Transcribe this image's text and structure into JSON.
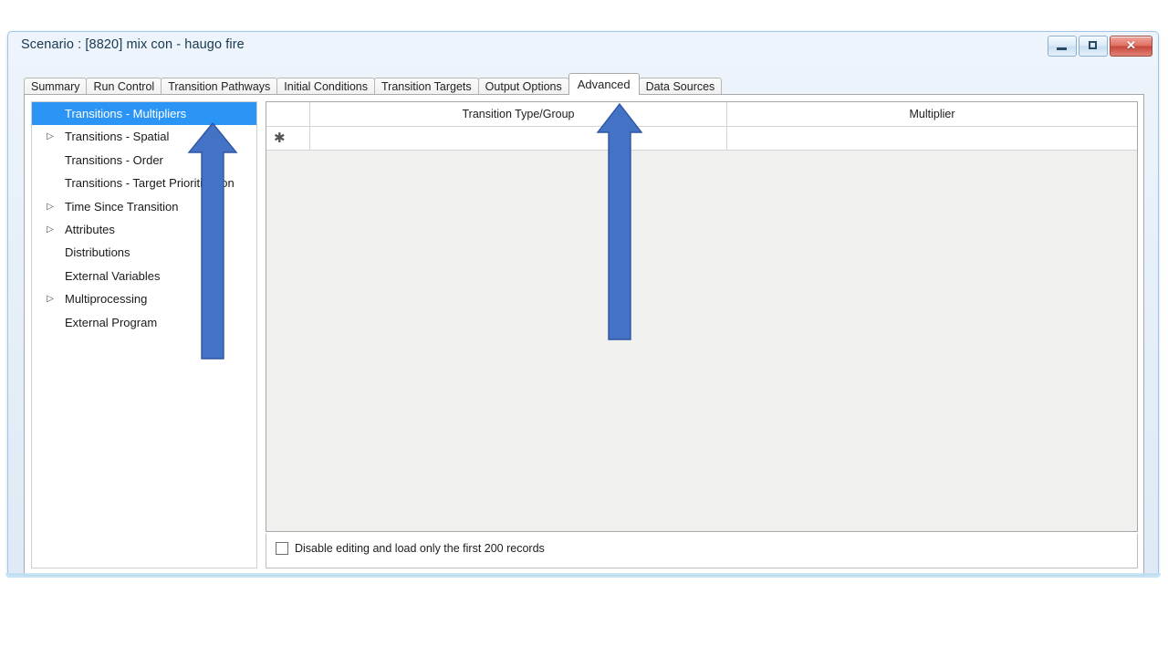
{
  "window": {
    "title": "Scenario : [8820] mix con - haugo fire",
    "controls": [
      {
        "name": "minimize-button",
        "glyph": "minimize-icon"
      },
      {
        "name": "maximize-button",
        "glyph": "maximize-icon"
      },
      {
        "name": "close-button",
        "glyph": "close-icon",
        "label": "✕"
      }
    ],
    "accent_color": "#9fc6e8"
  },
  "tabs": {
    "selected": "Advanced",
    "items": [
      {
        "label": "Summary"
      },
      {
        "label": "Run Control"
      },
      {
        "label": "Transition Pathways"
      },
      {
        "label": "Initial Conditions"
      },
      {
        "label": "Transition Targets"
      },
      {
        "label": "Output Options"
      },
      {
        "label": "Advanced"
      },
      {
        "label": "Data Sources"
      }
    ]
  },
  "tree": {
    "selected": "Transitions - Multipliers",
    "selection_color": "#2a95f5",
    "items": [
      {
        "label": "Transitions - Multipliers",
        "expandable": false,
        "selected": true
      },
      {
        "label": "Transitions - Spatial",
        "expandable": true,
        "selected": false
      },
      {
        "label": "Transitions - Order",
        "expandable": false,
        "selected": false
      },
      {
        "label": "Transitions - Target Prioritization",
        "expandable": false,
        "selected": false
      },
      {
        "label": "Time Since Transition",
        "expandable": true,
        "selected": false
      },
      {
        "label": "Attributes",
        "expandable": true,
        "selected": false
      },
      {
        "label": "Distributions",
        "expandable": false,
        "selected": false
      },
      {
        "label": "External Variables",
        "expandable": false,
        "selected": false
      },
      {
        "label": "Multiprocessing",
        "expandable": true,
        "selected": false
      },
      {
        "label": "External Program",
        "expandable": false,
        "selected": false
      }
    ],
    "expand_glyph": "▷"
  },
  "grid": {
    "columns": [
      {
        "label": ""
      },
      {
        "label": "Transition Type/Group"
      },
      {
        "label": "Multiplier"
      }
    ],
    "rows": [
      {
        "marker": "✱",
        "type_group": "",
        "multiplier": ""
      }
    ]
  },
  "footer": {
    "checkbox_label": "Disable editing and load only the first 200 records",
    "checkbox_checked": false
  },
  "annotations": {
    "arrow_color": "#4472c4",
    "arrow_border": "#2f55a4",
    "arrows": [
      {
        "name": "arrow-pointing-to-transitions-multipliers",
        "target": "Transitions - Multipliers"
      },
      {
        "name": "arrow-pointing-to-advanced-tab",
        "target": "Advanced"
      }
    ]
  }
}
